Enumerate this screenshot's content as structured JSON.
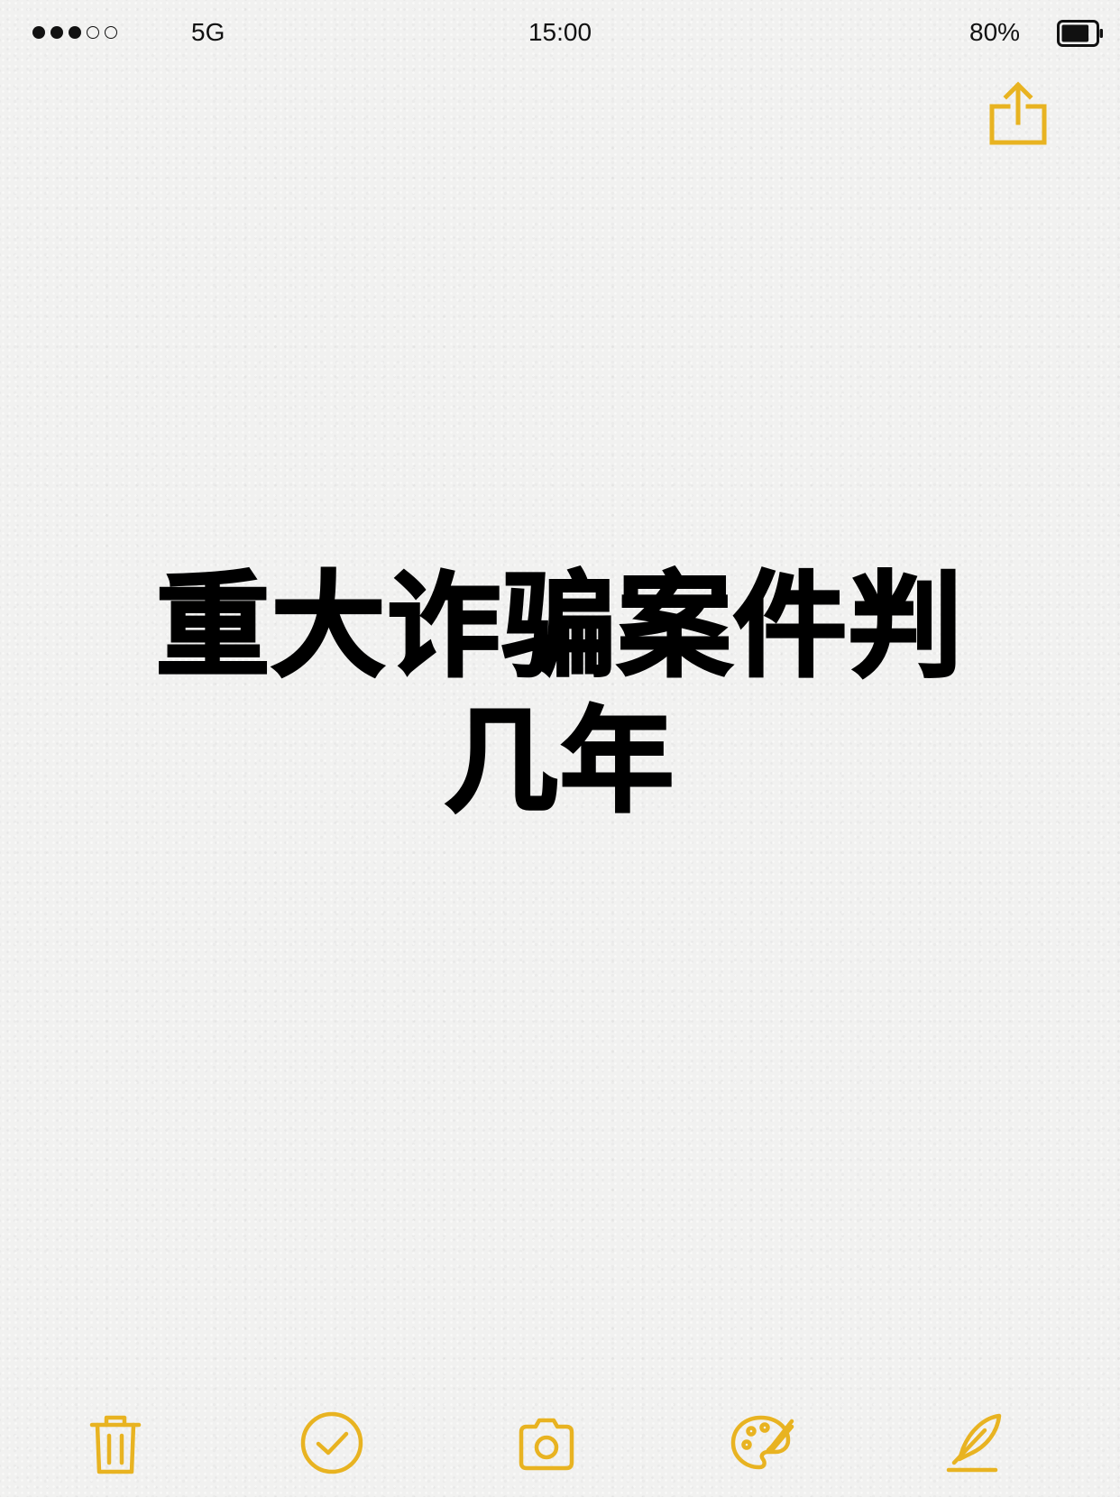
{
  "status_bar": {
    "signal_filled": 3,
    "signal_total": 5,
    "carrier": "5G",
    "time": "15:00",
    "battery_percent": "80%",
    "battery_level": 0.8
  },
  "note": {
    "title_line1": "重大诈骗案件判",
    "title_line2": "几年"
  },
  "toolbar": {
    "items": [
      {
        "icon": "trash-icon"
      },
      {
        "icon": "checkmark-circle-icon"
      },
      {
        "icon": "camera-icon"
      },
      {
        "icon": "palette-icon"
      },
      {
        "icon": "pen-icon"
      }
    ]
  },
  "colors": {
    "accent": "#E8B321",
    "text": "#000000",
    "background": "#F1F1F0"
  }
}
